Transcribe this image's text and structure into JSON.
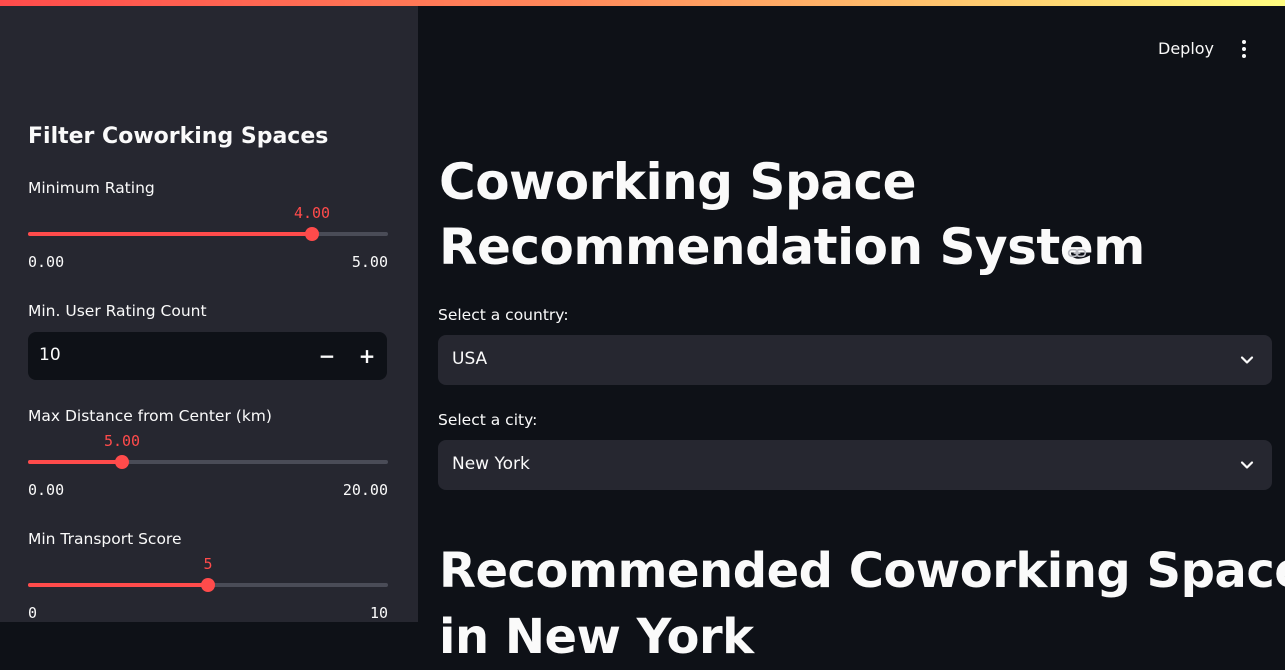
{
  "header": {
    "deploy_label": "Deploy",
    "menu_icon": "kebab-menu-icon"
  },
  "sidebar": {
    "title": "Filter Coworking Spaces",
    "min_rating": {
      "label": "Minimum Rating",
      "value": 4.0,
      "value_text": "4.00",
      "min": 0,
      "max": 5,
      "min_text": "0.00",
      "max_text": "5.00"
    },
    "min_user_rating_count": {
      "label": "Min. User Rating Count",
      "value": "10",
      "minus": "−",
      "plus": "+"
    },
    "max_distance": {
      "label": "Max Distance from Center (km)",
      "value": 5.0,
      "value_text": "5.00",
      "min": 0,
      "max": 20,
      "min_text": "0.00",
      "max_text": "20.00"
    },
    "min_transport": {
      "label": "Min Transport Score",
      "value": 5,
      "value_text": "5",
      "min": 0,
      "max": 10,
      "min_text": "0",
      "max_text": "10"
    }
  },
  "main": {
    "title_line1": "Coworking Space",
    "title_line2": "Recommendation System",
    "link_icon": "link-icon",
    "country": {
      "label": "Select a country:",
      "value": "USA"
    },
    "city": {
      "label": "Select a city:",
      "value": "New York"
    },
    "results_heading_line1": "Recommended Coworking Spaces",
    "results_heading_line2": "in New York"
  },
  "colors": {
    "accent": "#ff4b4b",
    "sidebar_bg": "#262730",
    "main_bg": "#0e1117",
    "text": "#fafafa"
  }
}
